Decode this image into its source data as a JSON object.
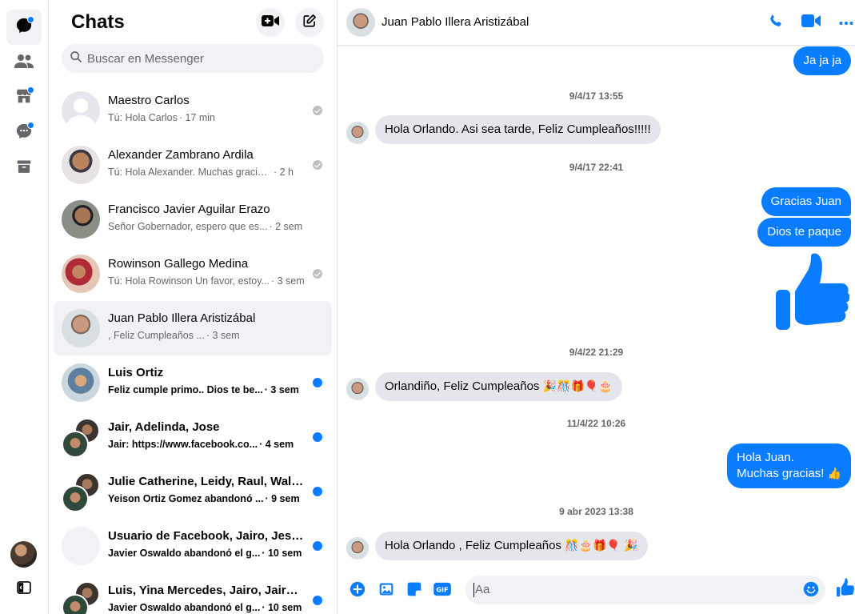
{
  "rail": {
    "items": [
      {
        "icon": "chat-bubble-icon",
        "active": true,
        "badge": true
      },
      {
        "icon": "people-icon",
        "active": false,
        "badge": false
      },
      {
        "icon": "marketplace-icon",
        "active": false,
        "badge": true
      },
      {
        "icon": "message-requests-icon",
        "active": false,
        "badge": true
      },
      {
        "icon": "archive-icon",
        "active": false,
        "badge": false
      }
    ],
    "bottom": [
      "profile-avatar",
      "sidebar-toggle-icon"
    ]
  },
  "list": {
    "title": "Chats",
    "search_placeholder": "Buscar en Messenger",
    "chats": [
      {
        "name": "Maestro Carlos",
        "preview": "Tú: Hola Carlos",
        "time": "· 17 min",
        "status": "read",
        "unread": false,
        "active": false
      },
      {
        "name": "Alexander Zambrano Ardila",
        "preview": "Tú: Hola Alexander. Muchas gracias ...",
        "time": "· 2 h",
        "status": "read",
        "unread": false,
        "active": false
      },
      {
        "name": "Francisco Javier Aguilar Erazo",
        "preview": "Señor Gobernador, espero que es...",
        "time": "· 2 sem",
        "status": "none",
        "unread": false,
        "active": false
      },
      {
        "name": "Rowinson Gallego Medina",
        "preview": "Tú: Hola Rowinson Un favor, estoy...",
        "time": "· 3 sem",
        "status": "read",
        "unread": false,
        "active": false
      },
      {
        "name": "Juan Pablo Illera Aristizábal",
        "preview": ", Feliz Cumpleaños ...",
        "time": "· 3 sem",
        "status": "none",
        "unread": false,
        "active": true
      },
      {
        "name": "Luis Ortiz",
        "preview": "Feliz cumple primo.. Dios te be...",
        "time": "· 3 sem",
        "status": "unread",
        "unread": true,
        "active": false
      },
      {
        "name": "Jair, Adelinda, Jose",
        "preview": "Jair: https://www.facebook.co...",
        "time": "· 4 sem",
        "status": "unread",
        "unread": true,
        "active": false
      },
      {
        "name": "Julie Catherine, Leidy, Raul, Walt...",
        "preview": "Yeison Ortiz Gomez abandonó ...",
        "time": "· 9 sem",
        "status": "unread",
        "unread": true,
        "active": false
      },
      {
        "name": "Usuario de Facebook, Jairo, Jesu...",
        "preview": "Javier Oswaldo abandonó el g...",
        "time": "· 10 sem",
        "status": "unread",
        "unread": true,
        "active": false
      },
      {
        "name": "Luis, Yina Mercedes, Jairo, Jairo,...",
        "preview": "Javier Oswaldo abandonó el g...",
        "time": "· 10 sem",
        "status": "unread",
        "unread": true,
        "active": false
      }
    ]
  },
  "conversation": {
    "contact_name": "Juan Pablo Illera Aristizábal",
    "messages": [
      {
        "type": "out",
        "text": "Ja ja ja"
      },
      {
        "type": "timestamp",
        "text": "9/4/17 13:55"
      },
      {
        "type": "in",
        "text": "Hola Orlando. Asi sea tarde, Feliz Cumpleaños!!!!!"
      },
      {
        "type": "timestamp",
        "text": "9/4/17 22:41"
      },
      {
        "type": "out",
        "text": "Gracias Juan"
      },
      {
        "type": "out",
        "text": "Dios te paque"
      },
      {
        "type": "thumbs",
        "text": ""
      },
      {
        "type": "timestamp",
        "text": "9/4/22 21:29"
      },
      {
        "type": "in",
        "text": "Orlandiño, Feliz Cumpleaños",
        "emoji": "🎉🎊🎁🎈🎂"
      },
      {
        "type": "timestamp",
        "text": "11/4/22 10:26"
      },
      {
        "type": "out",
        "text": "Hola Juan.",
        "text2": "Muchas gracias!",
        "emoji": "👍"
      },
      {
        "type": "timestamp",
        "text": "9 abr 2023 13:38"
      },
      {
        "type": "in",
        "text": "Hola Orlando , Feliz Cumpleaños",
        "emoji": "🎊🎂🎁🎈 🎉"
      }
    ],
    "composer_placeholder": "Aa"
  },
  "colors": {
    "accent": "#0a7cff",
    "incoming_bubble": "#e4e6eb",
    "hover": "#f0f2f5",
    "muted_text": "#65676b"
  }
}
